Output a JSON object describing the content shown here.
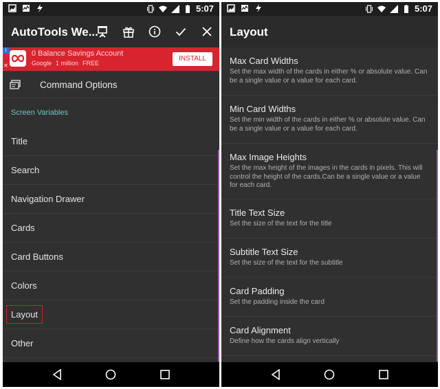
{
  "colors": {
    "background": "#303030",
    "accent": "#6cc3c5",
    "highlight_border": "#c0262c",
    "scroll_indicator": "#9b59b6",
    "ad_background": "#d8242e"
  },
  "status_bar": {
    "time": "5:07"
  },
  "left_screen": {
    "app_bar": {
      "title": "AutoTools We...",
      "actions": [
        "presentation-icon",
        "gift-icon",
        "info-icon",
        "check-icon",
        "close-icon"
      ]
    },
    "ad": {
      "title": "0 Balance Savings Account",
      "subtitle": "Google",
      "downloads": "1 million",
      "price": "FREE",
      "install_label": "INSTALL"
    },
    "command_options_label": "Command Options",
    "section_header": "Screen Variables",
    "items": [
      {
        "label": "Title"
      },
      {
        "label": "Search"
      },
      {
        "label": "Navigation Drawer"
      },
      {
        "label": "Cards"
      },
      {
        "label": "Card Buttons"
      },
      {
        "label": "Colors"
      },
      {
        "label": "Layout"
      },
      {
        "label": "Other"
      }
    ]
  },
  "right_screen": {
    "app_bar": {
      "title": "Layout"
    },
    "items": [
      {
        "title": "Max Card Widths",
        "description": "Set the max width of the cards in either % or absolute value. Can be a single value or a value for each card."
      },
      {
        "title": "Min Card Widths",
        "description": "Set the min width of the cards in either % or absolute value. Can be a single value or a value for each card."
      },
      {
        "title": "Max Image Heights",
        "description": "Set the max height of the images in the cards in pixels. This will control the height of the cards.Can  be a single value or a value for each card."
      },
      {
        "title": "Title Text Size",
        "description": "Set the size of the text for the title"
      },
      {
        "title": "Subtitle Text Size",
        "description": "Set the size of the text for the subtitle"
      },
      {
        "title": "Card Padding",
        "description": "Set the padding inside the card"
      },
      {
        "title": "Card Alignment",
        "description": "Define how the cards align vertically"
      }
    ]
  },
  "nav_bar": {
    "buttons": [
      "back-icon",
      "home-icon",
      "recents-icon"
    ]
  }
}
